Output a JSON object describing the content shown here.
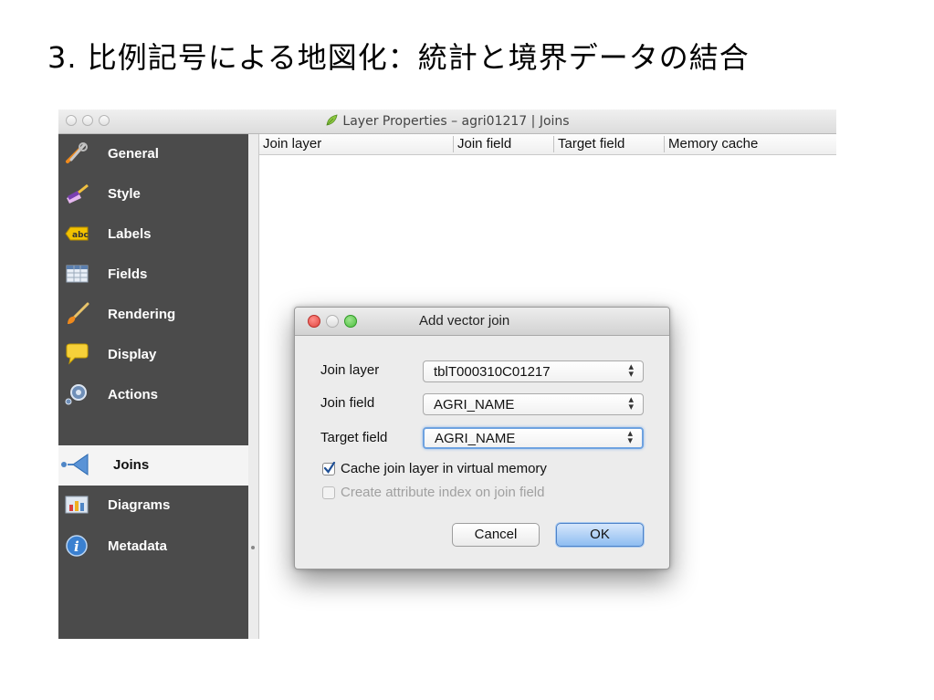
{
  "slide": {
    "title": "3. 比例記号による地図化：統計と境界データの結合"
  },
  "window": {
    "title": "Layer Properties – agri01217 | Joins"
  },
  "sidebar": {
    "items": [
      {
        "label": "General",
        "icon": "tools-icon"
      },
      {
        "label": "Style",
        "icon": "paintbrush-icon"
      },
      {
        "label": "Labels",
        "icon": "abc-label-icon",
        "icon_text": "abc"
      },
      {
        "label": "Fields",
        "icon": "table-icon"
      },
      {
        "label": "Rendering",
        "icon": "brush-icon"
      },
      {
        "label": "Display",
        "icon": "speech-bubble-icon"
      },
      {
        "label": "Actions",
        "icon": "gear-icon"
      },
      {
        "label": "Joins",
        "icon": "join-arrow-icon",
        "active": true
      },
      {
        "label": "Diagrams",
        "icon": "diagram-icon"
      },
      {
        "label": "Metadata",
        "icon": "info-icon",
        "icon_text": "i"
      }
    ]
  },
  "table": {
    "columns": [
      "Join layer",
      "Join field",
      "Target field",
      "Memory cache"
    ]
  },
  "dialog": {
    "title": "Add vector join",
    "join_layer_label": "Join layer",
    "join_layer_value": "tblT000310C01217",
    "join_field_label": "Join field",
    "join_field_value": "AGRI_NAME",
    "target_field_label": "Target field",
    "target_field_value": "AGRI_NAME",
    "cache_label": "Cache join layer in virtual memory",
    "cache_checked": true,
    "index_label": "Create attribute index on join field",
    "index_checked": false,
    "cancel_label": "Cancel",
    "ok_label": "OK"
  },
  "colors": {
    "sidebar_bg": "#4b4b4b",
    "accent": "#6ea2e0",
    "close": "#e0443e",
    "minimize": "#dfb43e",
    "zoom": "#4cbf3f"
  }
}
